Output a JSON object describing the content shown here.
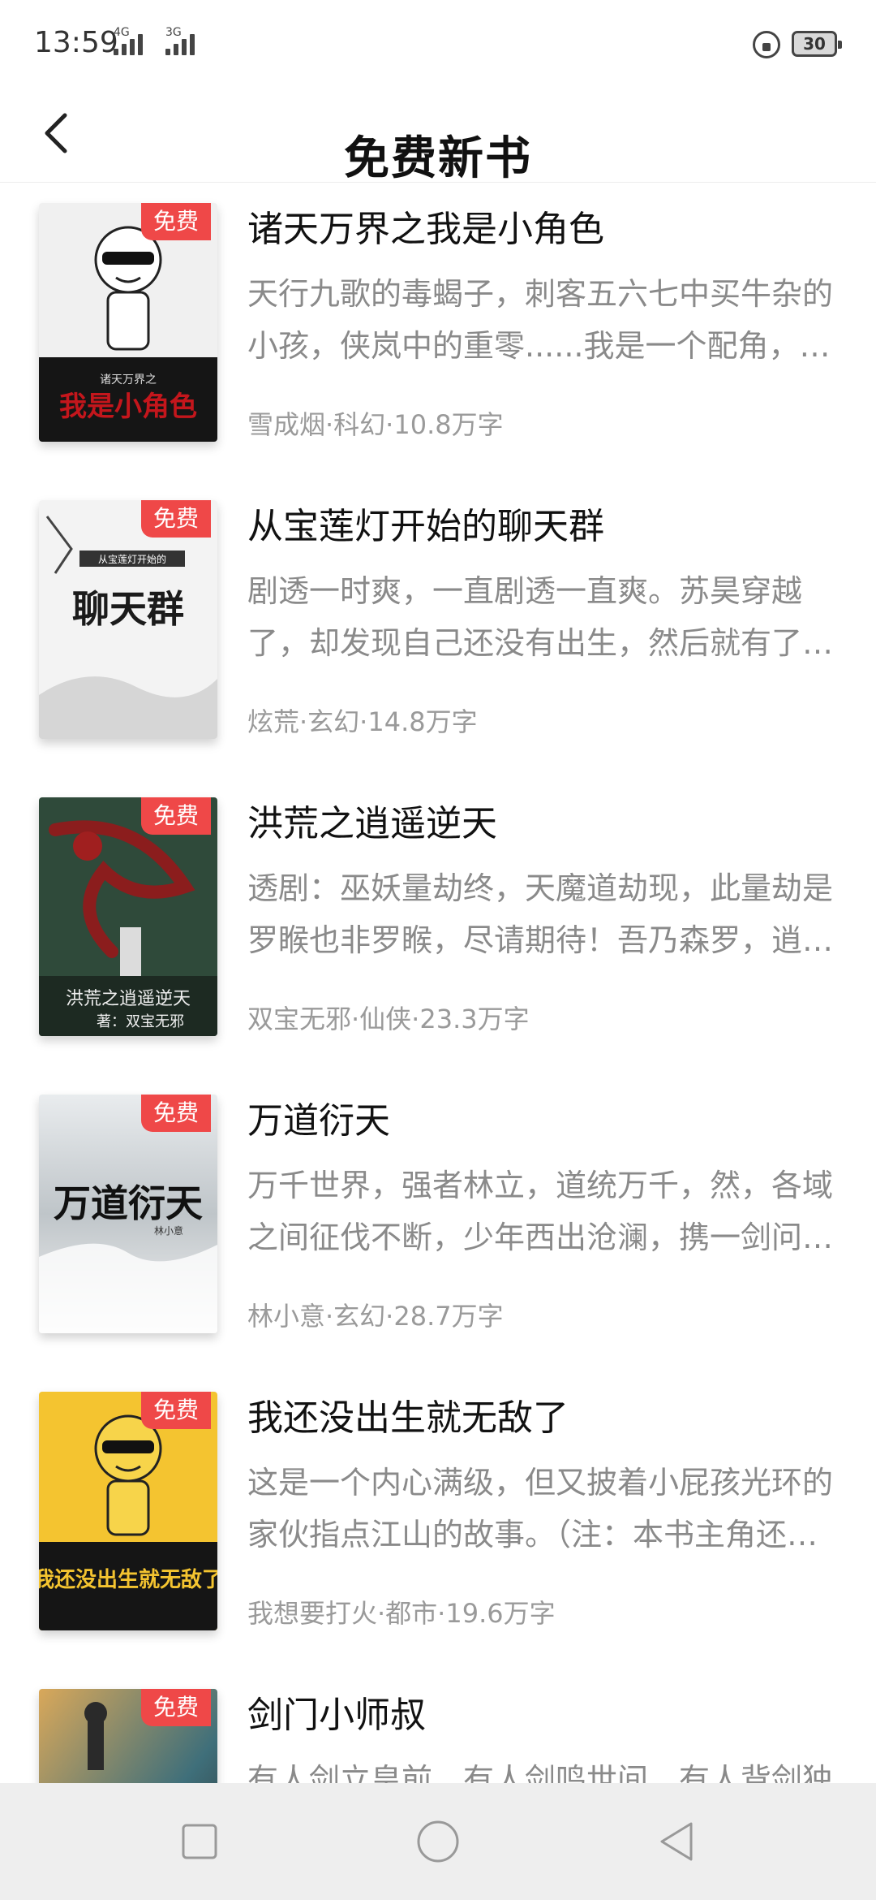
{
  "status": {
    "time": "13:59",
    "network_a": "4G",
    "network_b": "3G",
    "battery": "30"
  },
  "header": {
    "title": "免费新书"
  },
  "books": [
    {
      "badge": "免费",
      "title": "诸天万界之我是小角色",
      "desc": "天行九歌的毒蝎子，刺客五六七中买牛杂的小孩，侠岚中的重零......我是一个配角，活在另一个主角的背后，作为一个小角色。",
      "author": "雪成烟",
      "genre": "科幻",
      "words": "10.8万字",
      "meta": "雪成烟·科幻·10.8万字",
      "cover_title": "我是小角色",
      "cover_sub": "诸天万界之",
      "cover_colors": [
        "#f2f2f2",
        "#1a1a1a",
        "#b5141a"
      ]
    },
    {
      "badge": "免费",
      "title": "从宝莲灯开始的聊天群",
      "desc": "剧透一时爽，一直剧透一直爽。苏昊穿越了，却发现自己还没有出生，然后就有了一个聊天群。",
      "author": "炫荒",
      "genre": "玄幻",
      "words": "14.8万字",
      "meta": "炫荒·玄幻·14.8万字",
      "cover_title": "聊天群",
      "cover_sub": "从宝莲灯开始的",
      "cover_colors": [
        "#f4f4f4",
        "#cfcfcf",
        "#222222"
      ]
    },
    {
      "badge": "免费",
      "title": "洪荒之逍遥逆天",
      "desc": "透剧：巫妖量劫终，天魔道劫现，此量劫是罗睺也非罗睺，尽请期待！吾乃森罗，逍遥于天地之间。",
      "author": "双宝无邪",
      "genre": "仙侠",
      "words": "23.3万字",
      "meta": "双宝无邪·仙侠·23.3万字",
      "cover_title": "洪荒之逍遥逆天",
      "cover_sub": "著：双宝无邪",
      "cover_colors": [
        "#2f4a3a",
        "#7a1e1e",
        "#1d2a22"
      ]
    },
    {
      "badge": "免费",
      "title": "万道衍天",
      "desc": "万千世界，强者林立，道统万千，然，各域之间征伐不断，少年西出沧澜，携一剑问道天下。",
      "author": "林小意",
      "genre": "玄幻",
      "words": "28.7万字",
      "meta": "林小意·玄幻·28.7万字",
      "cover_title": "万道衍天",
      "cover_sub": "林小意",
      "cover_colors": [
        "#e9ecee",
        "#9aa3a8",
        "#111111"
      ]
    },
    {
      "badge": "免费",
      "title": "我还没出生就无敌了",
      "desc": "这是一个内心满级，但又披着小屁孩光环的家伙指点江山的故事。（注：本书主角还没出生。）",
      "author": "我想要打火",
      "genre": "都市",
      "words": "19.6万字",
      "meta": "我想要打火·都市·19.6万字",
      "cover_title": "我还没出生就无敌了",
      "cover_sub": "",
      "cover_colors": [
        "#f4c430",
        "#1a1a1a",
        "#f4c430"
      ]
    },
    {
      "badge": "免费",
      "title": "剑门小师叔",
      "desc": "有人剑立皇前，有人剑鸣世间，有人背剑独行天涯。",
      "author": "",
      "genre": "",
      "words": "",
      "meta": "",
      "cover_title": "",
      "cover_sub": "",
      "cover_colors": [
        "#3f6f7a",
        "#c9a25a",
        "#2a2a2a"
      ]
    }
  ],
  "icons": {
    "back": "back-arrow-icon",
    "recent": "recent-apps-icon",
    "home": "home-icon",
    "back_nav": "back-triangle-icon"
  }
}
